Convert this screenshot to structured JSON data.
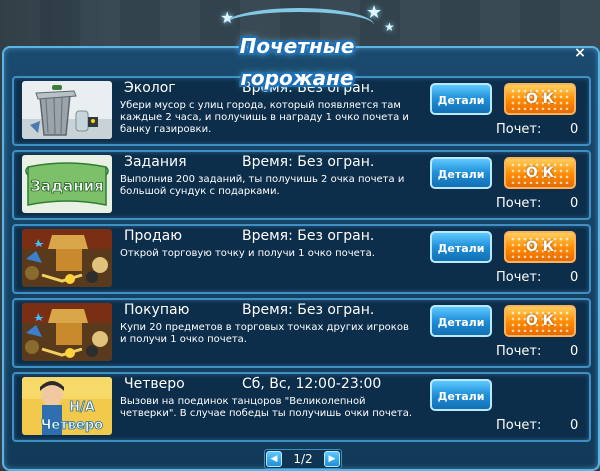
{
  "banner": {
    "title": "Почетные горожане"
  },
  "close_label": "×",
  "details_label": "Детали",
  "ok_label": "О К",
  "score_label": "Почет:",
  "quests": [
    {
      "title": "Эколог",
      "time": "Время: Без огран.",
      "description": "Убери мусор с улиц города, который появляется там каждые 2 часа, и получишь в награду 1 очко почета и  банку газировки.",
      "score": "0",
      "has_ok": true,
      "thumb_icon": "trash-can-icon"
    },
    {
      "title": "Задания",
      "time": "Время: Без огран.",
      "description": "Выполнив 200 заданий, ты получишь 2 очка почета и большой сундук с подарками.",
      "score": "0",
      "has_ok": true,
      "thumb_icon": "tasks-scroll-icon",
      "thumb_text": "Задания"
    },
    {
      "title": "Продаю",
      "time": "Время: Без огран.",
      "description": "Открой торговую точку и получи 1 очко почета.",
      "score": "0",
      "has_ok": true,
      "thumb_icon": "market-stall-icon"
    },
    {
      "title": "Покупаю",
      "time": "Время: Без огран.",
      "description": "Купи 20 предметов в торговых точках других игроков и получи 1 очко почета.",
      "score": "0",
      "has_ok": true,
      "thumb_icon": "market-stall-icon"
    },
    {
      "title": "Четверо",
      "time": "Сб, Вс, 12:00-23:00",
      "description": "Вызови на поединок танцоров \"Великолепной четверки\". В случае победы ты получишь очки почета.",
      "score": "0",
      "has_ok": false,
      "thumb_icon": "dancer-icon",
      "thumb_text_top": "Н/А",
      "thumb_text": "Четверо"
    }
  ],
  "pager": {
    "text": "1/2",
    "prev": "◀",
    "next": "▶"
  },
  "colors": {
    "panel": "#1a4a6e",
    "row_bg": "#0c2e4a",
    "row_border": "#3d8fc4",
    "details_button": "#1f8fd8",
    "ok_button": "#ff8a00"
  }
}
